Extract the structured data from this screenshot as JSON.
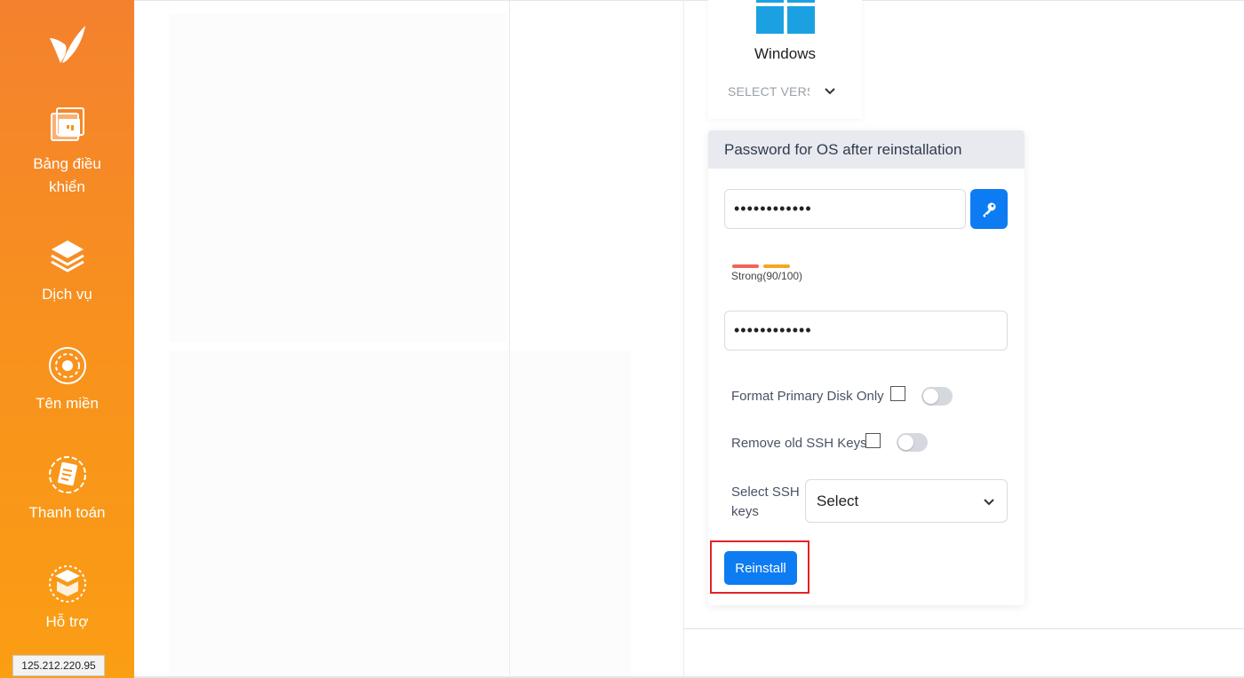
{
  "sidebar": {
    "items": [
      {
        "label": "Bảng điều khiển",
        "icon": "dashboard-icon"
      },
      {
        "label": "Dịch vụ",
        "icon": "services-layers-icon"
      },
      {
        "label": "Tên miền",
        "icon": "domain-globe-icon"
      },
      {
        "label": "Thanh toán",
        "icon": "billing-document-icon"
      },
      {
        "label": "Hỗ trợ",
        "icon": "support-box-icon"
      }
    ]
  },
  "status_bar": {
    "ip": "125.212.220.95"
  },
  "os_card": {
    "name": "Windows",
    "version_placeholder": "SELECT VERSION"
  },
  "password_panel": {
    "title": "Password for OS after reinstallation",
    "password_value": "••••••••••••",
    "confirm_value": "••••••••••••",
    "strength_text": "Strong(90/100)",
    "strength_colors": [
      "#f0645a",
      "#f5a623"
    ],
    "format_disk_label": "Format Primary Disk Only",
    "format_disk_enabled": false,
    "remove_ssh_label": "Remove old SSH Keys",
    "remove_ssh_enabled": false,
    "select_ssh_label": "Select SSH keys",
    "select_ssh_value": "Select",
    "reinstall_label": "Reinstall"
  },
  "colors": {
    "accent_orange": "#f8931c",
    "primary_blue": "#0d7cf2",
    "highlight_red": "#e32424"
  }
}
